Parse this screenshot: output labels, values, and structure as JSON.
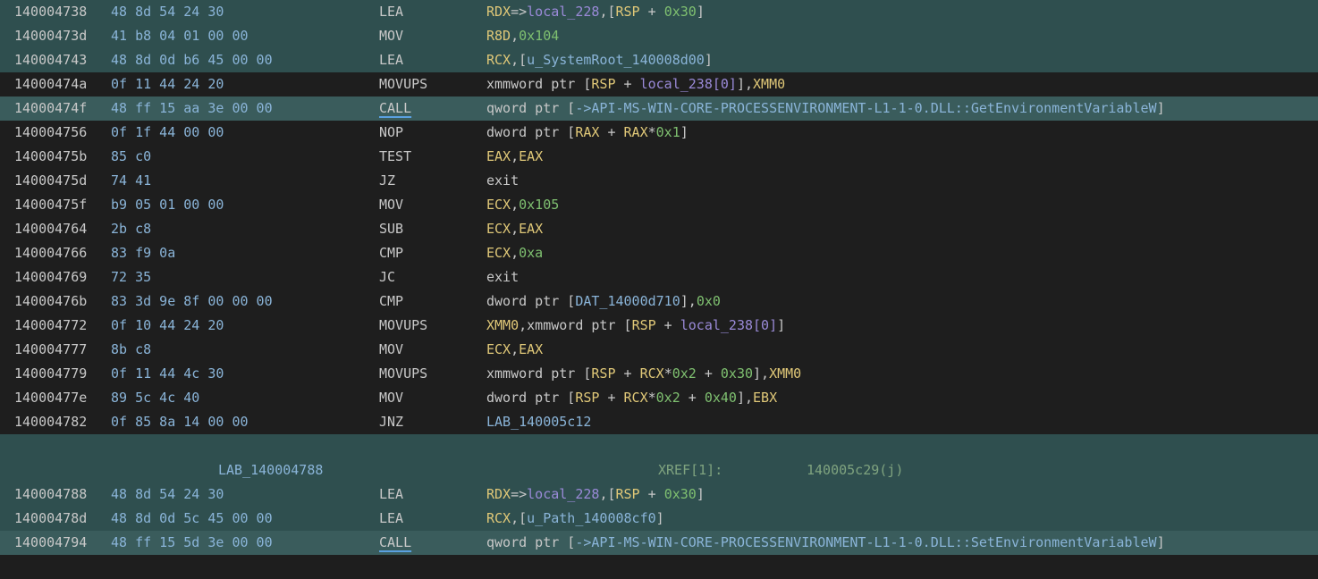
{
  "rows": [
    {
      "addr": "140004738",
      "bytes": "48 8d 54 24 30",
      "mnem": "LEA",
      "style": "hl-a",
      "ops": [
        [
          "reg",
          "RDX"
        ],
        [
          "txt",
          "=>"
        ],
        [
          "var",
          "local_228"
        ],
        [
          "txt",
          ",["
        ],
        [
          "reg",
          "RSP"
        ],
        [
          "txt",
          " + "
        ],
        [
          "num",
          "0x30"
        ],
        [
          "txt",
          "]"
        ]
      ]
    },
    {
      "addr": "14000473d",
      "bytes": "41 b8 04 01 00 00",
      "mnem": "MOV",
      "style": "hl-a",
      "ops": [
        [
          "reg",
          "R8D"
        ],
        [
          "txt",
          ","
        ],
        [
          "num",
          "0x104"
        ]
      ]
    },
    {
      "addr": "140004743",
      "bytes": "48 8d 0d b6 45 00 00",
      "mnem": "LEA",
      "style": "hl-a",
      "ops": [
        [
          "reg",
          "RCX"
        ],
        [
          "txt",
          ",["
        ],
        [
          "sym",
          "u_SystemRoot_140008d00"
        ],
        [
          "txt",
          "]"
        ]
      ]
    },
    {
      "addr": "14000474a",
      "bytes": "0f 11 44 24 20",
      "mnem": "MOVUPS",
      "style": "dark",
      "ops": [
        [
          "txt",
          "xmmword ptr ["
        ],
        [
          "reg",
          "RSP"
        ],
        [
          "txt",
          " + "
        ],
        [
          "var",
          "local_238[0]"
        ],
        [
          "txt",
          "],"
        ],
        [
          "reg",
          "XMM0"
        ]
      ]
    },
    {
      "addr": "14000474f",
      "bytes": "48 ff 15 aa 3e 00 00",
      "mnem": "CALL",
      "style": "hl-b",
      "ops": [
        [
          "txt",
          "qword ptr ["
        ],
        [
          "sym",
          "->API-MS-WIN-CORE-PROCESSENVIRONMENT-L1-1-0.DLL::GetEnvironmentVariableW"
        ],
        [
          "txt",
          "]"
        ]
      ]
    },
    {
      "addr": "140004756",
      "bytes": "0f 1f 44 00 00",
      "mnem": "NOP",
      "style": "dark",
      "ops": [
        [
          "txt",
          "dword ptr ["
        ],
        [
          "reg",
          "RAX"
        ],
        [
          "txt",
          " + "
        ],
        [
          "reg",
          "RAX"
        ],
        [
          "txt",
          "*"
        ],
        [
          "num",
          "0x1"
        ],
        [
          "txt",
          "]"
        ]
      ]
    },
    {
      "addr": "14000475b",
      "bytes": "85 c0",
      "mnem": "TEST",
      "style": "dark",
      "ops": [
        [
          "reg",
          "EAX"
        ],
        [
          "txt",
          ","
        ],
        [
          "reg",
          "EAX"
        ]
      ]
    },
    {
      "addr": "14000475d",
      "bytes": "74 41",
      "mnem": "JZ",
      "style": "dark",
      "ops": [
        [
          "txt",
          "exit"
        ]
      ]
    },
    {
      "addr": "14000475f",
      "bytes": "b9 05 01 00 00",
      "mnem": "MOV",
      "style": "dark",
      "ops": [
        [
          "reg",
          "ECX"
        ],
        [
          "txt",
          ","
        ],
        [
          "num",
          "0x105"
        ]
      ]
    },
    {
      "addr": "140004764",
      "bytes": "2b c8",
      "mnem": "SUB",
      "style": "dark",
      "ops": [
        [
          "reg",
          "ECX"
        ],
        [
          "txt",
          ","
        ],
        [
          "reg",
          "EAX"
        ]
      ]
    },
    {
      "addr": "140004766",
      "bytes": "83 f9 0a",
      "mnem": "CMP",
      "style": "dark",
      "ops": [
        [
          "reg",
          "ECX"
        ],
        [
          "txt",
          ","
        ],
        [
          "num",
          "0xa"
        ]
      ]
    },
    {
      "addr": "140004769",
      "bytes": "72 35",
      "mnem": "JC",
      "style": "dark",
      "ops": [
        [
          "txt",
          "exit"
        ]
      ]
    },
    {
      "addr": "14000476b",
      "bytes": "83 3d 9e 8f 00 00 00",
      "mnem": "CMP",
      "style": "dark",
      "ops": [
        [
          "txt",
          "dword ptr ["
        ],
        [
          "sym",
          "DAT_14000d710"
        ],
        [
          "txt",
          "],"
        ],
        [
          "num",
          "0x0"
        ]
      ]
    },
    {
      "addr": "140004772",
      "bytes": "0f 10 44 24 20",
      "mnem": "MOVUPS",
      "style": "dark",
      "ops": [
        [
          "reg",
          "XMM0"
        ],
        [
          "txt",
          ",xmmword ptr ["
        ],
        [
          "reg",
          "RSP"
        ],
        [
          "txt",
          " + "
        ],
        [
          "var",
          "local_238[0]"
        ],
        [
          "txt",
          "]"
        ]
      ]
    },
    {
      "addr": "140004777",
      "bytes": "8b c8",
      "mnem": "MOV",
      "style": "dark",
      "ops": [
        [
          "reg",
          "ECX"
        ],
        [
          "txt",
          ","
        ],
        [
          "reg",
          "EAX"
        ]
      ]
    },
    {
      "addr": "140004779",
      "bytes": "0f 11 44 4c 30",
      "mnem": "MOVUPS",
      "style": "dark",
      "ops": [
        [
          "txt",
          "xmmword ptr ["
        ],
        [
          "reg",
          "RSP"
        ],
        [
          "txt",
          " + "
        ],
        [
          "reg",
          "RCX"
        ],
        [
          "txt",
          "*"
        ],
        [
          "num",
          "0x2"
        ],
        [
          "txt",
          " + "
        ],
        [
          "num",
          "0x30"
        ],
        [
          "txt",
          "],"
        ],
        [
          "reg",
          "XMM0"
        ]
      ]
    },
    {
      "addr": "14000477e",
      "bytes": "89 5c 4c 40",
      "mnem": "MOV",
      "style": "dark",
      "ops": [
        [
          "txt",
          "dword ptr ["
        ],
        [
          "reg",
          "RSP"
        ],
        [
          "txt",
          " + "
        ],
        [
          "reg",
          "RCX"
        ],
        [
          "txt",
          "*"
        ],
        [
          "num",
          "0x2"
        ],
        [
          "txt",
          " + "
        ],
        [
          "num",
          "0x40"
        ],
        [
          "txt",
          "],"
        ],
        [
          "reg",
          "EBX"
        ]
      ]
    },
    {
      "addr": "140004782",
      "bytes": "0f 85 8a 14 00 00",
      "mnem": "JNZ",
      "style": "dark",
      "ops": [
        [
          "sym",
          "LAB_140005c12"
        ]
      ]
    }
  ],
  "label_block": {
    "label": "LAB_140004788",
    "xref": "XREF[1]:",
    "xref_addr": "140005c29(j)"
  },
  "rows2": [
    {
      "addr": "140004788",
      "bytes": "48 8d 54 24 30",
      "mnem": "LEA",
      "style": "hl-a",
      "ops": [
        [
          "reg",
          "RDX"
        ],
        [
          "txt",
          "=>"
        ],
        [
          "var",
          "local_228"
        ],
        [
          "txt",
          ",["
        ],
        [
          "reg",
          "RSP"
        ],
        [
          "txt",
          " + "
        ],
        [
          "num",
          "0x30"
        ],
        [
          "txt",
          "]"
        ]
      ]
    },
    {
      "addr": "14000478d",
      "bytes": "48 8d 0d 5c 45 00 00",
      "mnem": "LEA",
      "style": "hl-a",
      "ops": [
        [
          "reg",
          "RCX"
        ],
        [
          "txt",
          ",["
        ],
        [
          "sym",
          "u_Path_140008cf0"
        ],
        [
          "txt",
          "]"
        ]
      ]
    },
    {
      "addr": "140004794",
      "bytes": "48 ff 15 5d 3e 00 00",
      "mnem": "CALL",
      "style": "hl-b",
      "ops": [
        [
          "txt",
          "qword ptr ["
        ],
        [
          "sym",
          "->API-MS-WIN-CORE-PROCESSENVIRONMENT-L1-1-0.DLL::SetEnvironmentVariableW"
        ],
        [
          "txt",
          "]"
        ]
      ]
    }
  ],
  "colors": {
    "background": "#1e1e1e",
    "highlight_a": "#2f4f4f",
    "highlight_b": "#3a5c5c",
    "register": "#e0c878",
    "number": "#7fc070",
    "variable": "#9a8ad8",
    "symbol": "#8ab4d8",
    "xref": "#7fa37f"
  }
}
